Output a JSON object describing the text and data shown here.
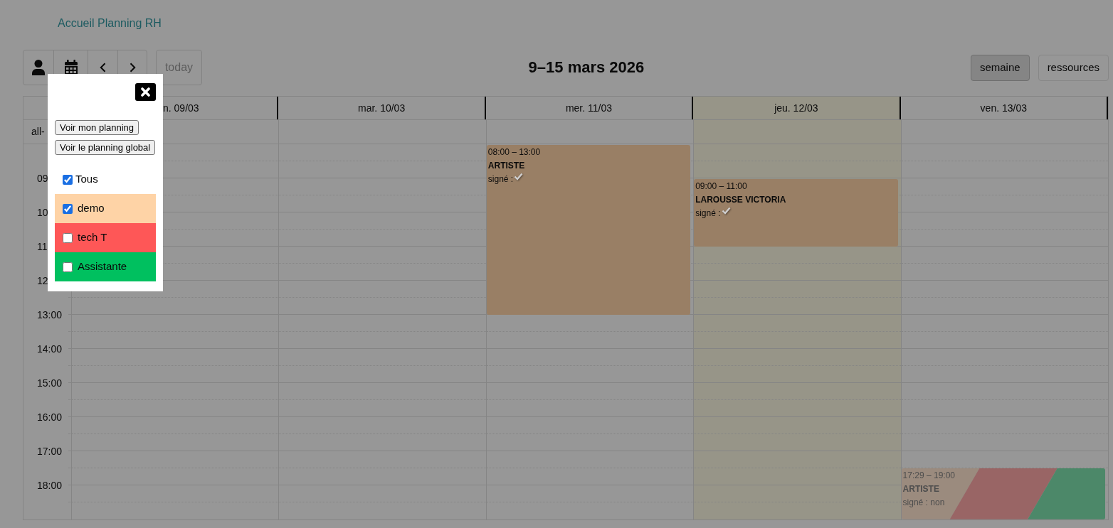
{
  "header": {
    "title": "Accueil Planning RH"
  },
  "toolbar": {
    "today": {
      "label": "today",
      "disabled": true
    },
    "title": "9–15 mars 2026",
    "views": [
      {
        "label": "semaine",
        "selected": true
      },
      {
        "label": "ressources",
        "selected": false
      }
    ]
  },
  "calendar": {
    "all_day_label": "all-",
    "time_labels": [
      "09",
      "10",
      "11",
      "12",
      "13:00",
      "14:00",
      "15:00",
      "16:00",
      "17:00",
      "18:00"
    ],
    "days": [
      {
        "label": "n. 09/03",
        "today": false
      },
      {
        "label": "mar. 10/03",
        "today": false
      },
      {
        "label": "mer. 11/03",
        "today": false,
        "events": [
          {
            "kind": "solid",
            "time": "08:00 – 13:00",
            "title": "ARTISTE",
            "status": "signé :",
            "check": true,
            "faded": false,
            "color": "#997f65"
          }
        ]
      },
      {
        "label": "jeu. 12/03",
        "today": true,
        "events": [
          {
            "kind": "solid",
            "time": "09:00 – 11:00",
            "title": "LAROUSSE VICTORIA",
            "status": "signé :",
            "check": true,
            "faded": false,
            "color": "#997f65"
          }
        ]
      },
      {
        "label": "ven. 13/03",
        "today": false,
        "events": [
          {
            "kind": "striped",
            "time": "17:29 – 19:00",
            "title": "ARTISTE",
            "status": "signé : non",
            "check": false,
            "faded": true,
            "stripes": [
              {
                "color": "#9b8b7e"
              },
              {
                "color": "#996565"
              },
              {
                "color": "#4c8869"
              }
            ]
          }
        ]
      }
    ]
  },
  "filter_popup": {
    "buttons": [
      "Voir mon planning",
      "Voir le planning global"
    ],
    "all": {
      "label": "Tous",
      "checked": true
    },
    "groups": [
      {
        "label": "demo",
        "checked": true,
        "color": "#fed3a6"
      },
      {
        "label": "tech T",
        "checked": false,
        "color": "#fe5757"
      },
      {
        "label": "Assistante",
        "checked": false,
        "color": "#00c05f"
      }
    ]
  }
}
